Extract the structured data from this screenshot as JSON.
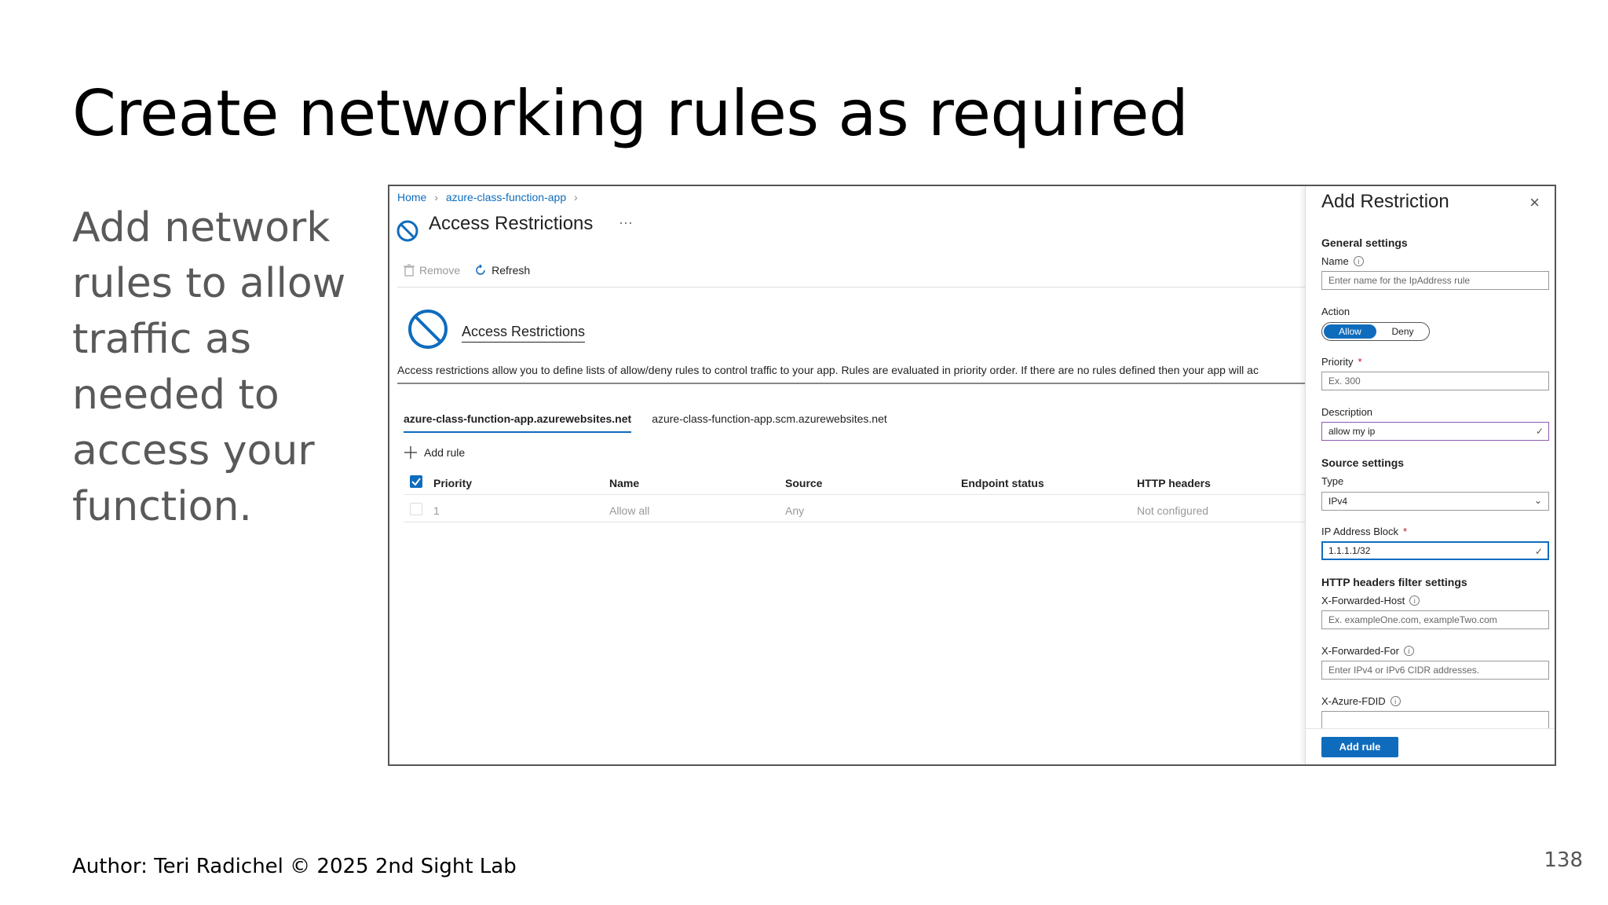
{
  "slide": {
    "title": "Create networking rules as required",
    "body": "Add network rules to allow traffic as needed to access your function.",
    "author": "Author: Teri Radichel © 2025 2nd Sight Lab",
    "page_number": "138"
  },
  "screenshot": {
    "breadcrumb": [
      "Home",
      "azure-class-function-app"
    ],
    "blade_title": "Access Restrictions",
    "more": "···",
    "toolbar": {
      "remove": "Remove",
      "refresh": "Refresh"
    },
    "section_heading": "Access Restrictions",
    "description": "Access restrictions allow you to define lists of allow/deny rules to control traffic to your app. Rules are evaluated in priority order. If there are no rules defined then your app will ac",
    "tabs": [
      "azure-class-function-app.azurewebsites.net",
      "azure-class-function-app.scm.azurewebsites.net"
    ],
    "add_rule": "Add rule",
    "table": {
      "columns": [
        "Priority",
        "Name",
        "Source",
        "Endpoint status",
        "HTTP headers"
      ],
      "rows": [
        {
          "priority": "1",
          "name": "Allow all",
          "source": "Any",
          "endpoint_status": "",
          "http_headers": "Not configured"
        }
      ]
    },
    "panel": {
      "title": "Add Restriction",
      "general_settings": "General settings",
      "name_label": "Name",
      "name_placeholder": "Enter name for the IpAddress rule",
      "action_label": "Action",
      "action_allow": "Allow",
      "action_deny": "Deny",
      "priority_label": "Priority",
      "priority_placeholder": "Ex. 300",
      "description_label": "Description",
      "description_value": "allow my ip",
      "source_settings": "Source settings",
      "type_label": "Type",
      "type_value": "IPv4",
      "ip_block_label": "IP Address Block",
      "ip_block_value": "1.1.1.1/32",
      "http_filter": "HTTP headers filter settings",
      "x_forwarded_host_label": "X-Forwarded-Host",
      "x_forwarded_host_placeholder": "Ex. exampleOne.com, exampleTwo.com",
      "x_forwarded_for_label": "X-Forwarded-For",
      "x_forwarded_for_placeholder": "Enter IPv4 or IPv6 CIDR addresses.",
      "x_azure_fdid_label": "X-Azure-FDID",
      "add_rule_button": "Add rule"
    },
    "colors": {
      "accent": "#0f6cbd",
      "required": "#c50f1f"
    }
  }
}
